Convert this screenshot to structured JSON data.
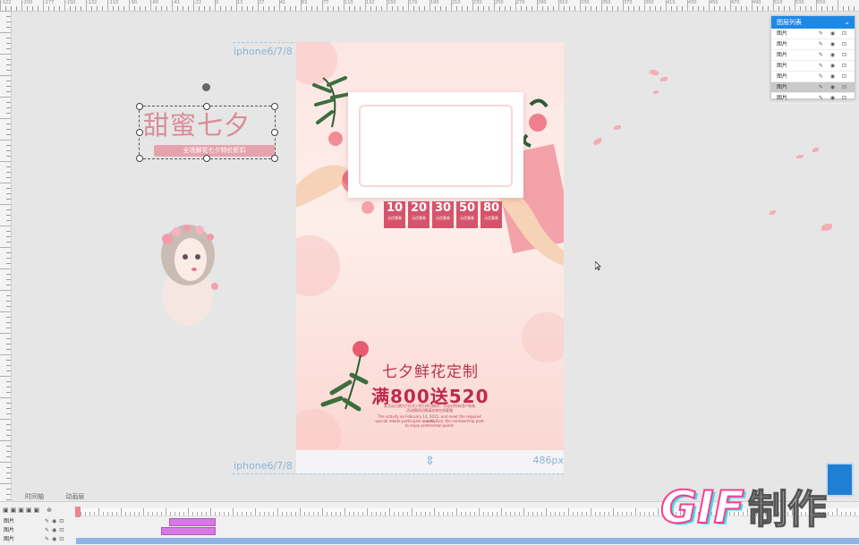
{
  "ruler": {
    "top_labels": [
      "-122",
      "-200",
      "-177",
      "-150",
      "-132",
      "-110",
      "-90",
      "-66",
      "-41",
      "-22",
      "0",
      "13",
      "27",
      "41",
      "63",
      "77",
      "110",
      "132",
      "150",
      "170",
      "190",
      "210",
      "230",
      "250",
      "270",
      "290",
      "310",
      "330",
      "350",
      "370",
      "390",
      "410",
      "430",
      "450",
      "470",
      "490",
      "510",
      "530",
      "550"
    ]
  },
  "canvas": {
    "device_label_top": "iphone6/7/8",
    "device_label_bottom": "iphone6/7/8",
    "height_readout": "486px"
  },
  "poster": {
    "discount_tags": [
      {
        "value": "10",
        "unit": "元优惠券"
      },
      {
        "value": "20",
        "unit": "元优惠券"
      },
      {
        "value": "30",
        "unit": "元优惠券"
      },
      {
        "value": "50",
        "unit": "元优惠券"
      },
      {
        "value": "80",
        "unit": "元优惠券"
      }
    ],
    "heading": "七夕鲜花定制",
    "promo": "满800送520",
    "fine_print": [
      "本活动日期为7月3日-8月18日期间，活动对所有用户有效",
      "活动期间详情请咨询在线客服",
      "The activity on February 14, 2015, and meet the required points,",
      "special rebate participate in activities, the membership poet",
      "to enjoy preferential points"
    ]
  },
  "title_element": {
    "main_text": "甜蜜七夕",
    "sub_text": "全场鲜花七夕特价折扣"
  },
  "layers_panel": {
    "title": "图层列表",
    "rows": [
      {
        "label": "图片",
        "selected": false
      },
      {
        "label": "图片",
        "selected": false
      },
      {
        "label": "图片",
        "selected": false
      },
      {
        "label": "图片",
        "selected": false
      },
      {
        "label": "图片",
        "selected": false
      },
      {
        "label": "图片",
        "selected": true
      },
      {
        "label": "图片",
        "selected": false
      }
    ],
    "row_icons": "✎ ◉ ⊡"
  },
  "timeline": {
    "tabs": [
      "时间轴",
      "动画层"
    ],
    "rows": [
      {
        "label": "图片"
      },
      {
        "label": "图片"
      },
      {
        "label": "图片"
      }
    ]
  },
  "watermark": {
    "text_latin": "GIF",
    "text_cjk": "制作"
  },
  "colors": {
    "accent_blue": "#1e88e5",
    "poster_red": "#c02a4a",
    "tag_red": "#d6546b",
    "timeline_bar": "#d57ae0",
    "watermark_pink": "#ff3c8e",
    "watermark_cyan": "#25e0e8"
  }
}
